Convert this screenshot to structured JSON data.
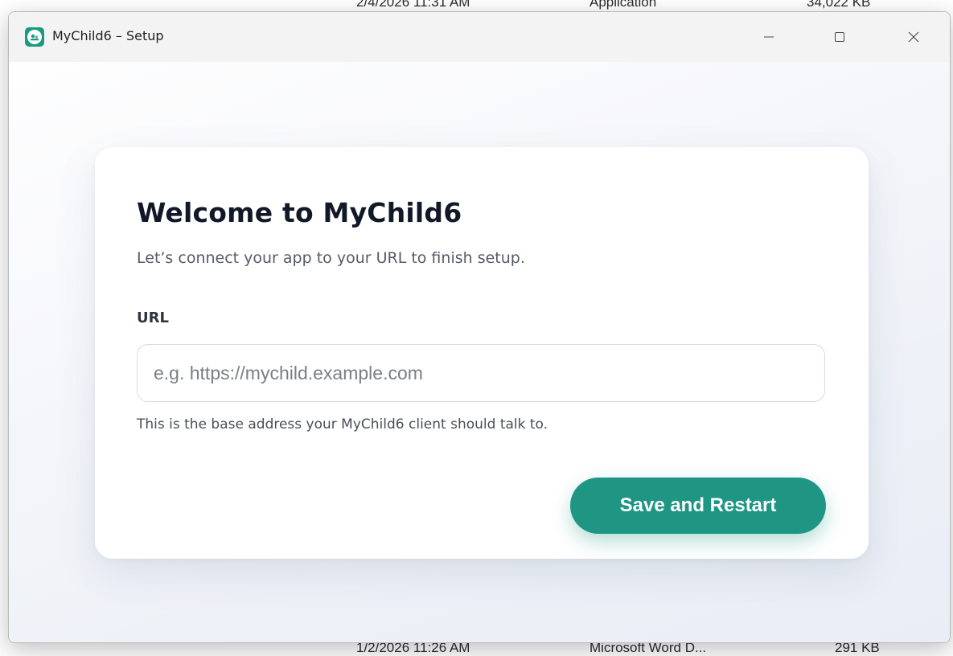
{
  "background": {
    "top_row": [
      "2/4/2026 11:31 AM",
      "Application",
      "34,022 KB"
    ],
    "bottom_row": [
      "1/2/2026 11:26 AM",
      "Microsoft Word D...",
      "291 KB"
    ]
  },
  "window": {
    "title": "MyChild6 – Setup",
    "app_icon": "mychild6-logo-icon",
    "controls": {
      "minimize": "—",
      "maximize": "☐",
      "close": "✕"
    }
  },
  "setup": {
    "title": "Welcome to MyChild6",
    "subtitle": "Let’s connect your app to your URL to finish setup.",
    "url_label": "URL",
    "url_value": "",
    "url_placeholder": "e.g. https://mychild.example.com",
    "url_help": "This is the base address your MyChild6 client should talk to.",
    "save_label": "Save and Restart"
  },
  "colors": {
    "accent": "#1f9684",
    "title_text": "#111827",
    "subtitle_text": "#555c66"
  }
}
